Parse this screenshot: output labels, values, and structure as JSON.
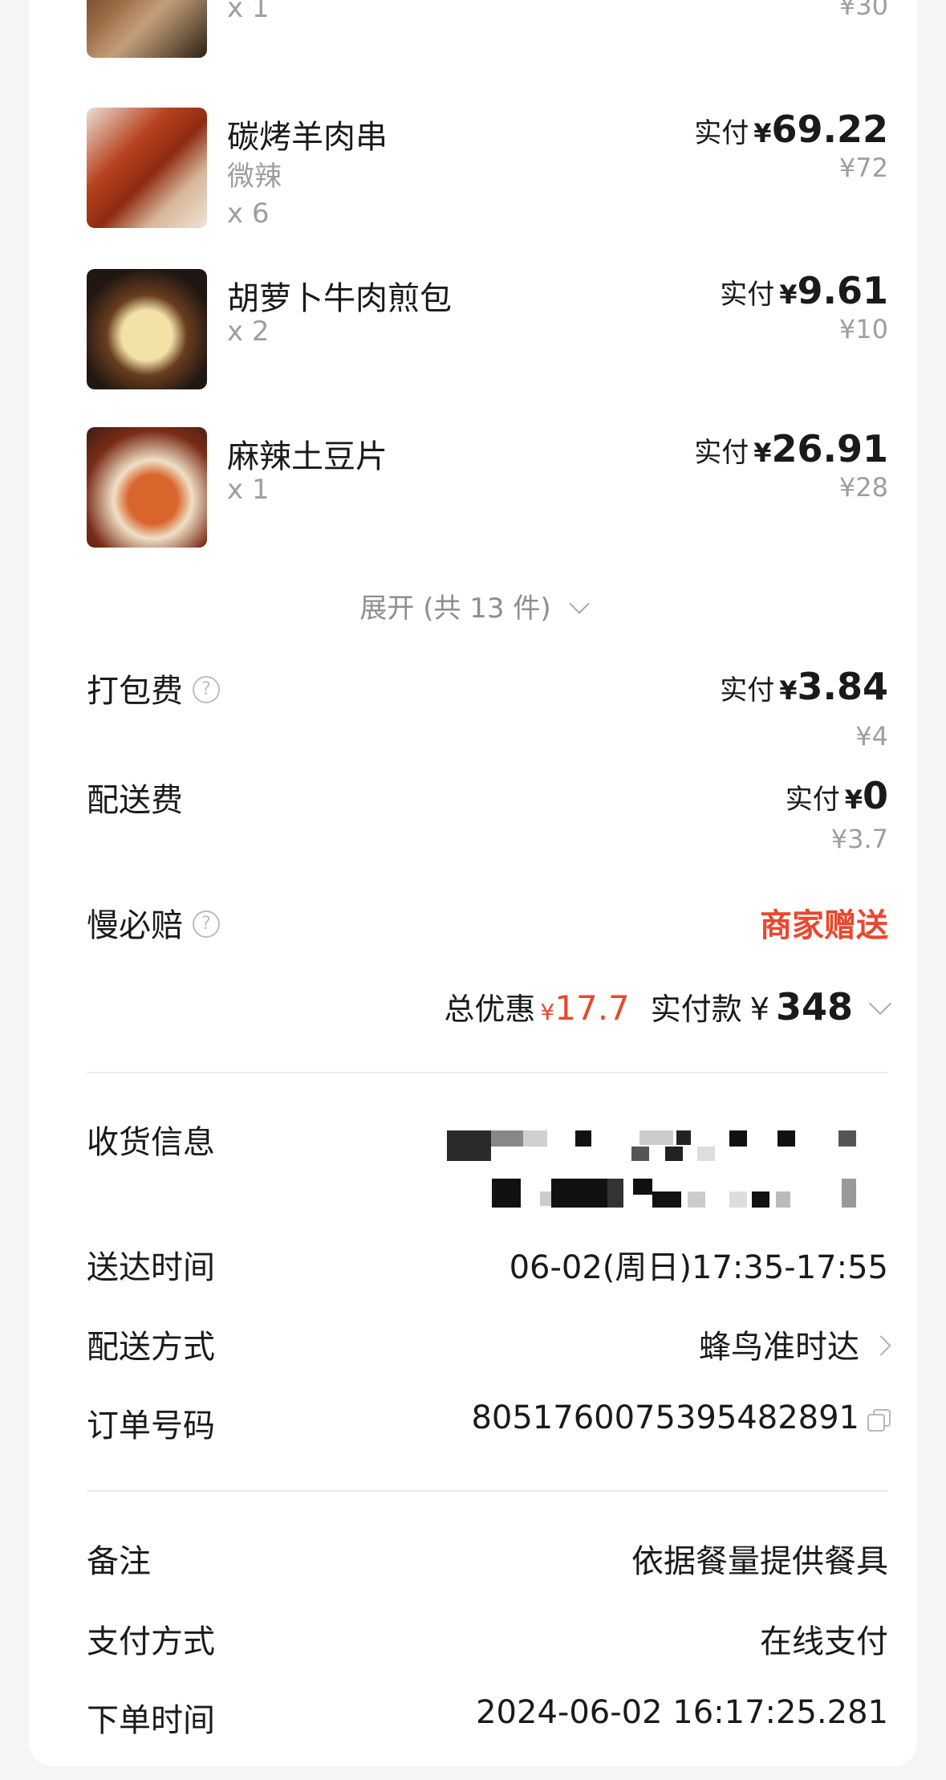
{
  "items": [
    {
      "name": "",
      "spec": "",
      "qty": "x 1",
      "paid_label": "",
      "paid_amount": "",
      "original": "¥30"
    },
    {
      "name": "碳烤羊肉串",
      "spec": "微辣",
      "qty": "x 6",
      "paid_label": "实付",
      "yen": "¥",
      "paid_amount": "69.22",
      "original": "¥72"
    },
    {
      "name": "胡萝卜牛肉煎包",
      "spec": "",
      "qty": "x 2",
      "paid_label": "实付",
      "yen": "¥",
      "paid_amount": "9.61",
      "original": "¥10"
    },
    {
      "name": "麻辣土豆片",
      "spec": "",
      "qty": "x 1",
      "paid_label": "实付",
      "yen": "¥",
      "paid_amount": "26.91",
      "original": "¥28"
    }
  ],
  "expand_label": "展开 (共 13 件)",
  "fees": {
    "packing": {
      "label": "打包费",
      "paid_label": "实付",
      "yen": "¥",
      "paid_amount": "3.84",
      "original": "¥4"
    },
    "delivery": {
      "label": "配送费",
      "paid_label": "实付",
      "yen": "¥",
      "paid_amount": "0",
      "original": "¥3.7"
    },
    "late_compensation": {
      "label": "慢必赔",
      "value": "商家赠送"
    }
  },
  "total": {
    "discount_label": "总优惠",
    "discount_yen": "¥",
    "discount_value": "17.7",
    "paid_label": "实付款",
    "paid_yen": "¥",
    "paid_value": "348"
  },
  "info": {
    "receiver_label": "收货信息",
    "delivery_time_label": "送达时间",
    "delivery_time": "06-02(周日)17:35-17:55",
    "delivery_method_label": "配送方式",
    "delivery_method": "蜂鸟准时达",
    "order_no_label": "订单号码",
    "order_no": "8051760075395482891",
    "remark_label": "备注",
    "remark": "依据餐量提供餐具",
    "payment_label": "支付方式",
    "payment": "在线支付",
    "order_time_label": "下单时间",
    "order_time": "2024-06-02 16:17:25.281"
  },
  "colors": {
    "accent_red": "#e8482f",
    "muted": "#9e9e9e"
  },
  "icons": [
    "question-icon",
    "chevron-down-icon",
    "chevron-right-icon",
    "copy-icon"
  ]
}
